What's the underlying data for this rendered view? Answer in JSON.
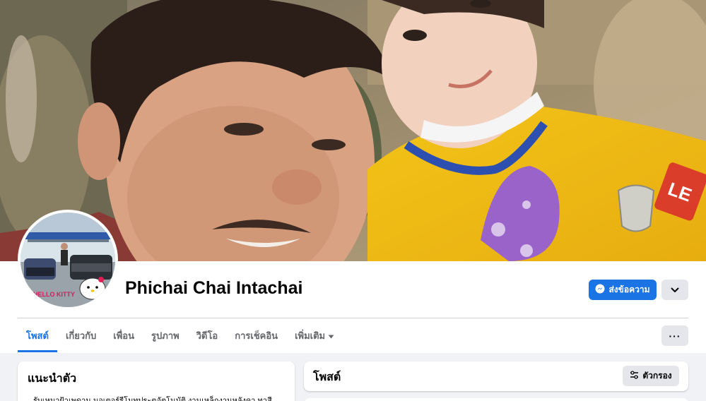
{
  "profile": {
    "name": "Phichai Chai Intachai",
    "message_label": "ส่งข้อความ",
    "avatar_badge": "HELLO KITTY"
  },
  "tabs": [
    {
      "label": "โพสต์"
    },
    {
      "label": "เกี่ยวกับ"
    },
    {
      "label": "เพื่อน"
    },
    {
      "label": "รูปภาพ"
    },
    {
      "label": "วิดีโอ"
    },
    {
      "label": "การเช็คอิน"
    },
    {
      "label": "เพิ่มเติม"
    }
  ],
  "more_dots": "···",
  "intro": {
    "title": "แนะนำตัว",
    "text": "รับเหมาฝ้าเพดาน มอเตอร์รีโมทประตูอัตโนมัติ งานเหล็กงานหลังคา ทาสี"
  },
  "posts": {
    "title": "โพสต์",
    "filter_label": "ตัวกรอง"
  },
  "colors": {
    "accent": "#1b74e4",
    "background": "#f0f2f5"
  }
}
